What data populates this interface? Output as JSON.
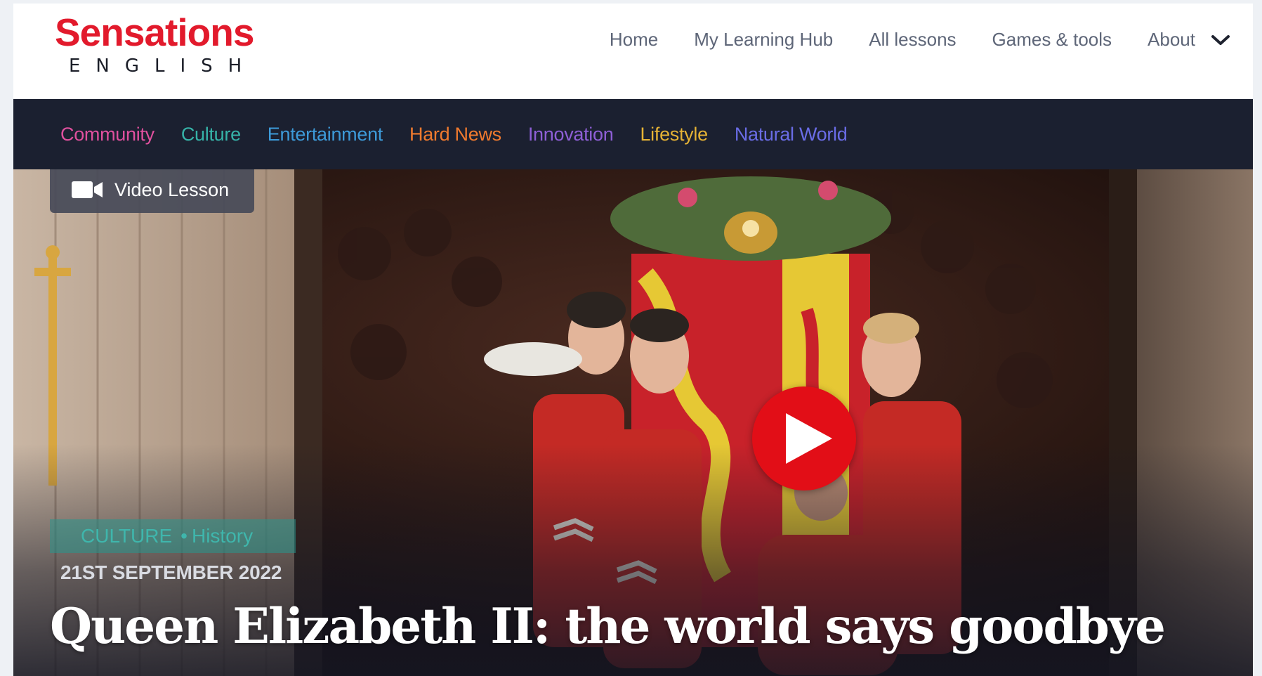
{
  "brand": {
    "name": "Sensations",
    "sub": "ENGLISH",
    "color": "#e21a2c"
  },
  "nav": {
    "items": [
      "Home",
      "My Learning Hub",
      "All lessons",
      "Games & tools"
    ],
    "about": "About",
    "about_icon": "chevron-down-icon"
  },
  "categories": [
    {
      "label": "Community",
      "color": "#e0509e"
    },
    {
      "label": "Culture",
      "color": "#36b3a8"
    },
    {
      "label": "Entertainment",
      "color": "#3d9ad8"
    },
    {
      "label": "Hard News",
      "color": "#f07a2e"
    },
    {
      "label": "Innovation",
      "color": "#8e5fd6"
    },
    {
      "label": "Lifestyle",
      "color": "#e6b335"
    },
    {
      "label": "Natural World",
      "color": "#6a6ce6"
    }
  ],
  "hero": {
    "badge": "Video Lesson",
    "badge_icon": "video-camera-icon",
    "play_icon": "play-icon",
    "tag_category": "CULTURE",
    "tag_separator": "•",
    "tag_topic": "History",
    "date": "21ST SEPTEMBER 2022",
    "title": "Queen Elizabeth II: the world says goodbye"
  }
}
